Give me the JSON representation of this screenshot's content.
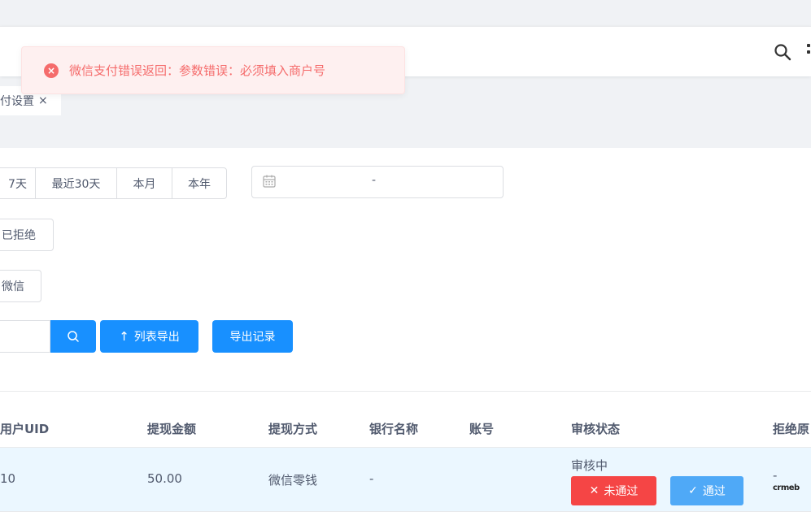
{
  "header": {
    "search_icon": "search-icon",
    "more_icon": "more-icon"
  },
  "tabs": [
    {
      "label": "付设置",
      "close": "×"
    }
  ],
  "filters": {
    "date_presets": [
      "7天",
      "最近30天",
      "本月",
      "本年"
    ],
    "date_range": {
      "separator": "-"
    },
    "status_option": "已拒绝",
    "type_option": "微信"
  },
  "actions": {
    "export_label": "列表导出",
    "export_arrow": "↑",
    "records_label": "导出记录"
  },
  "table": {
    "headers": [
      "用户UID",
      "提现金额",
      "提现方式",
      "银行名称",
      "账号",
      "审核状态",
      "拒绝原"
    ],
    "rows": [
      {
        "uid": "10",
        "amount": "50.00",
        "method": "微信零钱",
        "bank": "-",
        "account": "",
        "status": "审核中",
        "reject_reason": "-",
        "reject_label": "未通过",
        "reject_icon": "✕",
        "pass_label": "通过",
        "pass_icon": "✓"
      }
    ]
  },
  "toast": {
    "icon": "×",
    "message": "微信支付错误返回：参数错误：必须填入商户号"
  },
  "logo_text": "crmeb",
  "colors": {
    "primary": "#1890ff",
    "danger": "#f54545",
    "pass": "#4fa9f7",
    "toast_bg": "#fef0f0",
    "toast_text": "#f56c6c",
    "row_highlight": "#ebf7ff"
  }
}
